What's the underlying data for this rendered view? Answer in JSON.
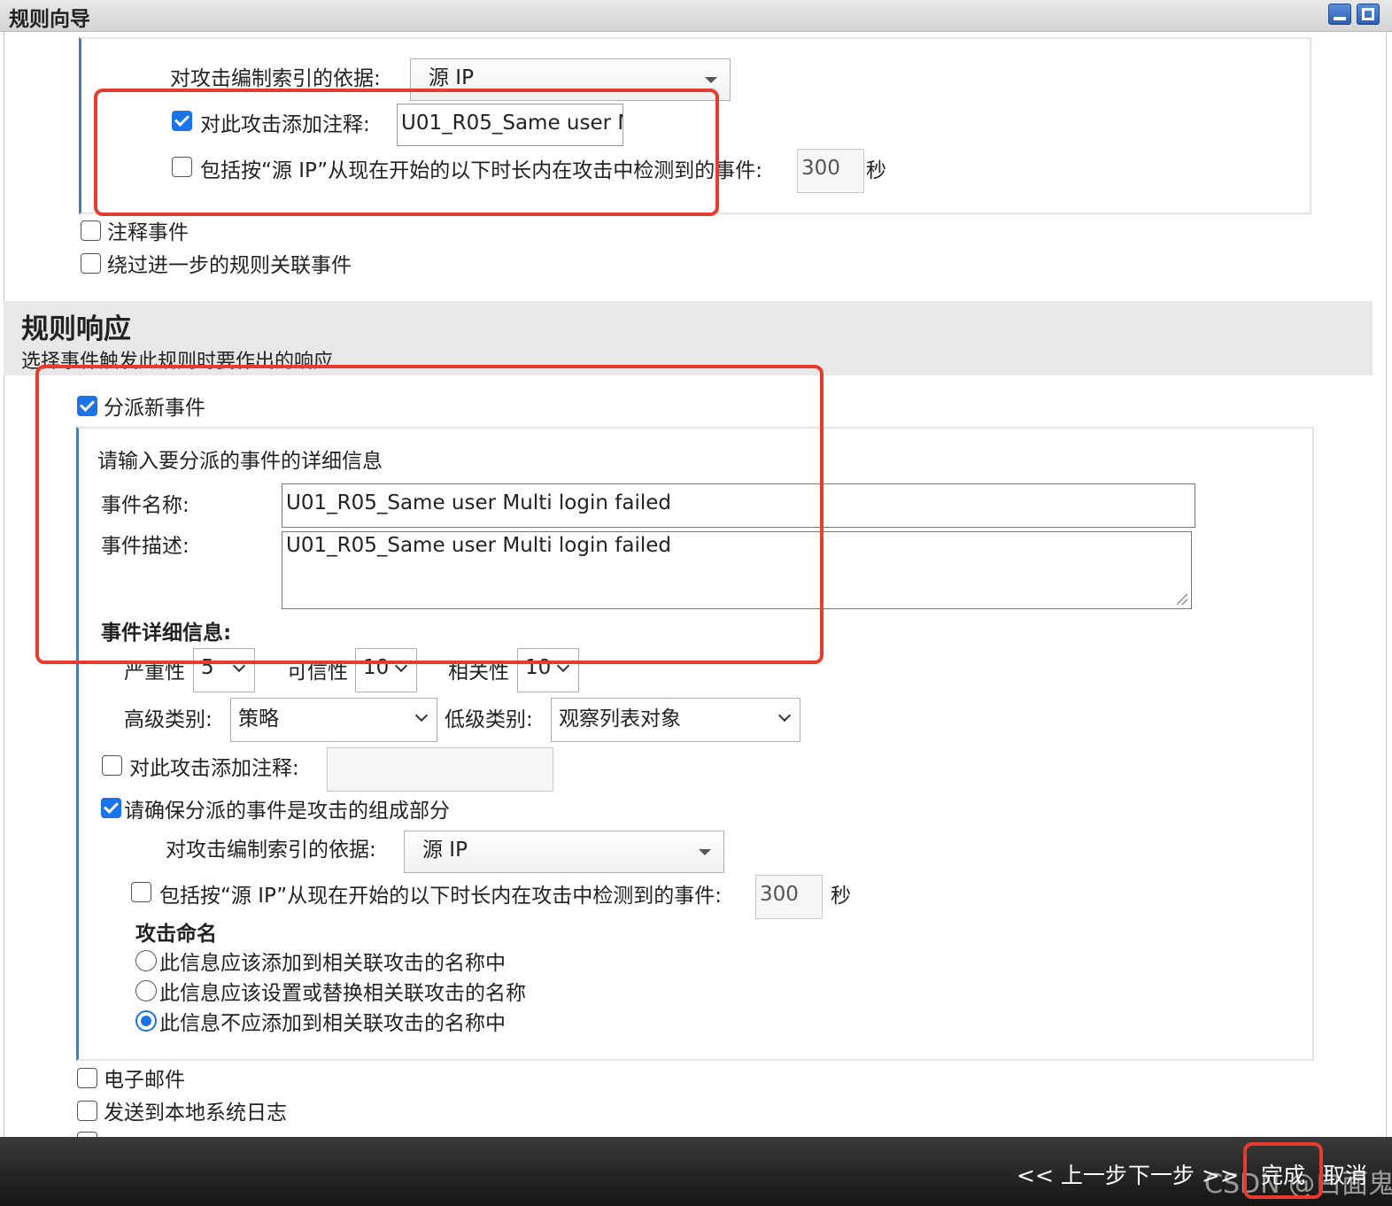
{
  "window": {
    "title": "规则向导"
  },
  "top_section": {
    "index_label": "对攻击编制索引的依据:",
    "index_value": "源 IP",
    "annotate_checked": true,
    "annotate_label": "对此攻击添加注释:",
    "annotate_value": "U01_R05_Same user M",
    "include_checked": false,
    "include_label": "包括按“源 IP”从现在开始的以下时长内在攻击中检测到的事件:",
    "include_value": "300",
    "include_unit": "秒",
    "annotate_event_label": "注释事件",
    "bypass_label": "绕过进一步的规则关联事件"
  },
  "rule_response": {
    "title": "规则响应",
    "subtitle": "选择事件触发此规则时要作出的响应",
    "dispatch_checked": true,
    "dispatch_label": "分派新事件",
    "details_prompt": "请输入要分派的事件的详细信息",
    "event_name_label": "事件名称:",
    "event_name_value": "U01_R05_Same user Multi login failed",
    "event_desc_label": "事件描述:",
    "event_desc_value": "U01_R05_Same user Multi login failed",
    "event_details_label": "事件详细信息:",
    "severity_label": "严重性",
    "severity_value": "5",
    "credibility_label": "可信性",
    "credibility_value": "10",
    "relevance_label": "相关性",
    "relevance_value": "10",
    "high_cat_label": "高级类别:",
    "high_cat_value": "策略",
    "low_cat_label": "低级类别:",
    "low_cat_value": "观察列表对象",
    "annotate_checked": false,
    "annotate_label": "对此攻击添加注释:",
    "ensure_checked": true,
    "ensure_label": "请确保分派的事件是攻击的组成部分",
    "index_label": "对攻击编制索引的依据:",
    "index_value": "源 IP",
    "include_checked": false,
    "include_label": "包括按“源 IP”从现在开始的以下时长内在攻击中检测到的事件:",
    "include_value": "300",
    "include_unit": "秒",
    "naming_title": "攻击命名",
    "naming_options": [
      "此信息应该添加到相关联攻击的名称中",
      "此信息应该设置或替换相关联攻击的名称",
      "此信息不应添加到相关联攻击的名称中"
    ],
    "naming_selected": 2,
    "email_label": "电子邮件",
    "syslog_label": "发送到本地系统日志"
  },
  "footer": {
    "prev": "<< 上一步",
    "next": "下一步 >>",
    "finish": "完成",
    "cancel": "取消",
    "watermark": "CSDN @白面鬼"
  },
  "colors": {
    "accent": "#1a73e8",
    "highlight": "#e53c2e",
    "panel_rule": "#4a7bb7"
  }
}
